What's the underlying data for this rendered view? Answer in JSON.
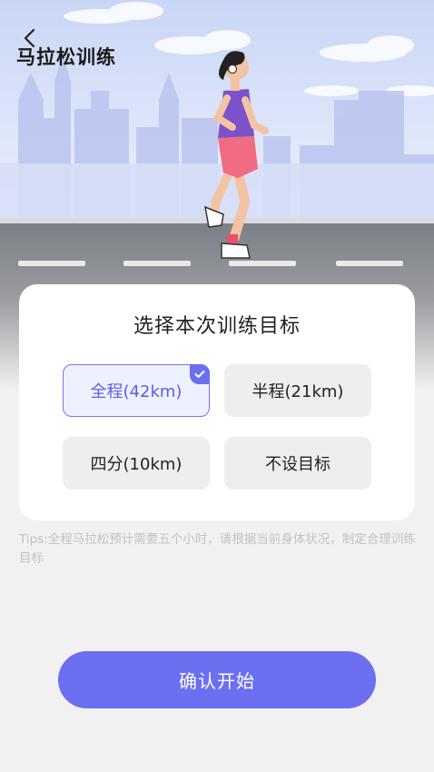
{
  "header": {
    "title": "马拉松训练",
    "back_icon": "chevron-left-icon"
  },
  "card": {
    "title": "选择本次训练目标",
    "options": [
      {
        "label": "全程(42km)",
        "selected": true
      },
      {
        "label": "半程(21km)",
        "selected": false
      },
      {
        "label": "四分(10km)",
        "selected": false
      },
      {
        "label": "不设目标",
        "selected": false
      }
    ]
  },
  "tips": "Tips:全程马拉松预计需要五个小时，请根据当前身体状况，制定合理训练目标",
  "confirm_label": "确认开始",
  "colors": {
    "accent": "#6b6ff0",
    "selected_bg": "#eef1ff",
    "page_bg": "#f1f1f1"
  }
}
